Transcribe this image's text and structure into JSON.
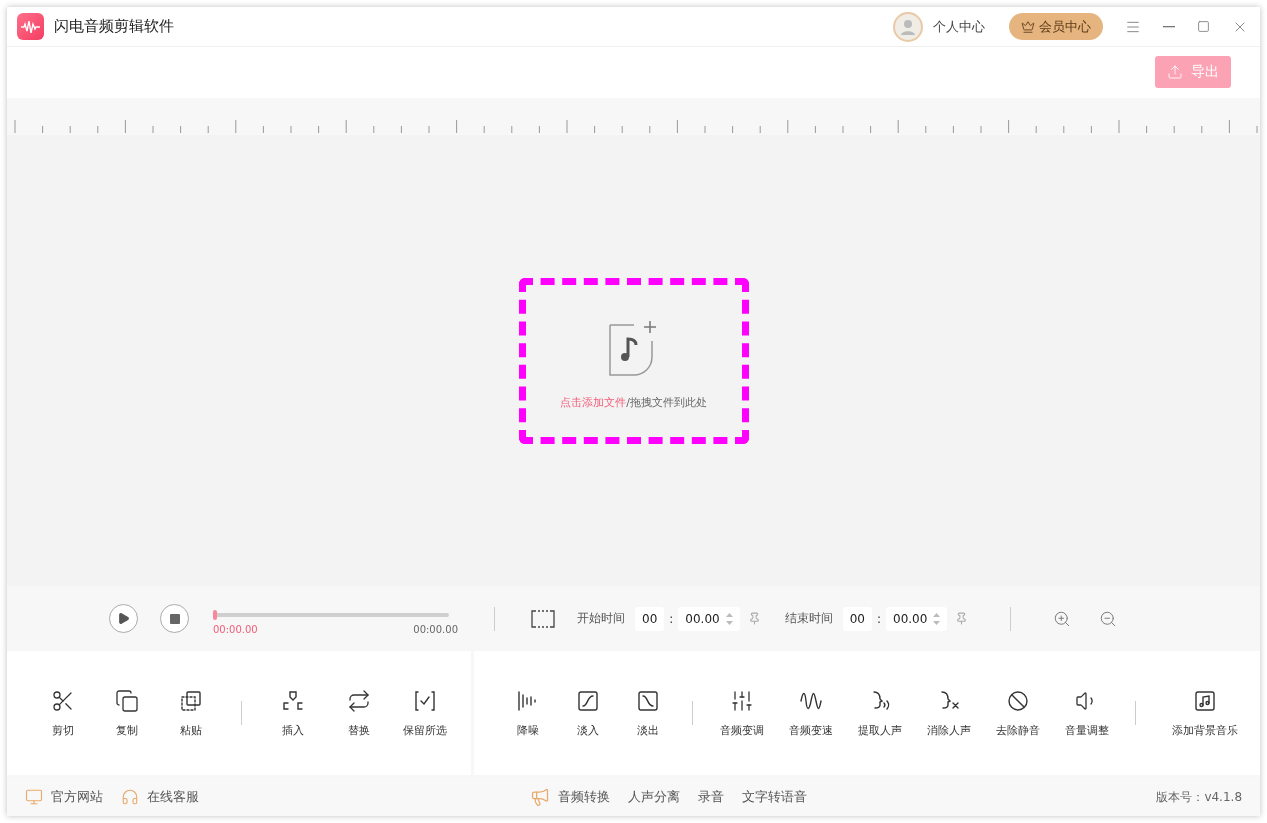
{
  "window": {
    "title": "闪电音频剪辑软件"
  },
  "header": {
    "user_label": "个人中心",
    "vip_label": "会员中心"
  },
  "export_button": {
    "label": "导出",
    "disabled": true
  },
  "drop_zone": {
    "link": "点击添加文件",
    "text": "/拖拽文件到此处"
  },
  "player": {
    "level": 0,
    "current_time": "00:00.00",
    "total_time": "00:00.00",
    "start_label": "开始时间",
    "start_min": "00",
    "start_colon": ":",
    "end_colon": ":",
    "start_sec": "00.00",
    "end_label": "结束时间",
    "end_min": "00",
    "end_sec": "00.00"
  },
  "tools_left": [
    [
      "剪切",
      "复制",
      "粘贴"
    ],
    [
      "插入",
      "替换",
      "保留所选"
    ]
  ],
  "tools_right": [
    [
      "降噪",
      "淡入",
      "淡出"
    ],
    [
      "音频变调",
      "音频变速",
      "提取人声",
      "消除人声",
      "去除静音",
      "音量调整"
    ],
    [
      "添加背景音乐"
    ]
  ],
  "footer": {
    "left_links": [
      "官方网站",
      "在线客服"
    ],
    "center_links": [
      "音频转换",
      "人声分离",
      "录音",
      "文字转语音"
    ],
    "version": "版本号：v4.1.8"
  }
}
